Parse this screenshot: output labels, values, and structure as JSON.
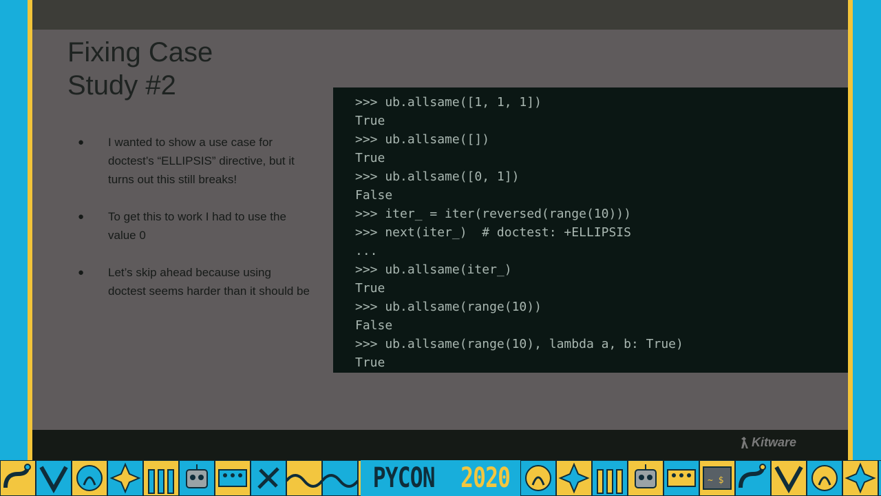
{
  "slide": {
    "title_line1": "Fixing Case",
    "title_line2": "Study #2",
    "bullets": [
      "I wanted to show a use case for doctest’s “ELLIPSIS” directive, but it turns out this still breaks!",
      "To get this to work I had to use the value 0",
      "Let’s skip ahead because using doctest seems harder than it should be"
    ],
    "bullet_glyph": "●"
  },
  "code": {
    "lines": [
      ">>> ub.allsame([1, 1, 1])",
      "True",
      ">>> ub.allsame([])",
      "True",
      ">>> ub.allsame([0, 1])",
      "False",
      ">>> iter_ = iter(reversed(range(10)))",
      ">>> next(iter_)  # doctest: +ELLIPSIS",
      "...",
      ">>> ub.allsame(iter_)",
      "True",
      ">>> ub.allsame(range(10))",
      "False",
      ">>> ub.allsame(range(10), lambda a, b: True)",
      "True"
    ],
    "background": "#0b1714"
  },
  "footer": {
    "logo_text": "Kitware"
  },
  "banner": {
    "word": "PYCON",
    "year": "2020",
    "colors": {
      "gold": "#f3c63f",
      "blue": "#18aedb",
      "navy": "#0f2d3a"
    },
    "tile_icons": [
      "snake-icon",
      "chevron-icon",
      "laurel-icon",
      "star-icon",
      "pillars-icon",
      "robot-icon",
      "keyboard-icon",
      "tools-icon",
      "wave-icon",
      "wave-icon",
      "chevron-icon",
      "laurel-icon",
      "star-icon",
      "pillars-icon",
      "robot-icon",
      "keyboard-icon",
      "terminal-icon",
      "snake-icon",
      "chevron-icon",
      "laurel-icon",
      "star-icon",
      "pillars-icon",
      "robot-icon"
    ],
    "terminal_prompt": "~ $"
  }
}
